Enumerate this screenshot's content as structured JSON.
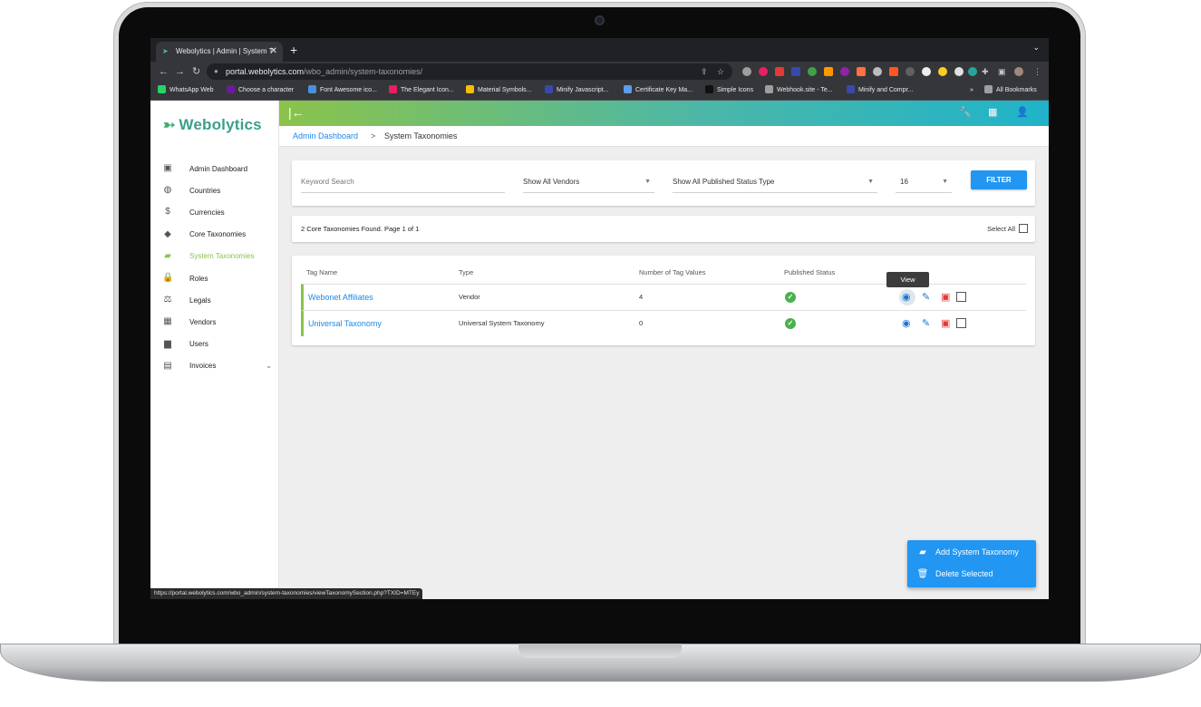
{
  "browser": {
    "tab_title": "Webolytics | Admin | System T",
    "tab_close": "✕",
    "new_tab": "+",
    "tab_menu": "⌄",
    "url_host": "portal.webolytics.com",
    "url_path": "/wbo_admin/system-taxonomies/",
    "bookmarks": [
      {
        "label": "WhatsApp Web",
        "color": "#25d366"
      },
      {
        "label": "Choose a character",
        "color": "#6a1b9a"
      },
      {
        "label": "Font Awesome ico...",
        "color": "#4a90d9"
      },
      {
        "label": "The Elegant Icon...",
        "color": "#e91e63"
      },
      {
        "label": "Material Symbols...",
        "color": "#fbbc04"
      },
      {
        "label": "Minify Javascript...",
        "color": "#3949ab"
      },
      {
        "label": "Certificate Key Ma...",
        "color": "#5c9ded"
      },
      {
        "label": "Simple Icons",
        "color": "#111111"
      },
      {
        "label": "Webhook.site - Te...",
        "color": "#9e9e9e"
      },
      {
        "label": "Minify and Compr...",
        "color": "#3949ab"
      }
    ],
    "bookmarks_overflow": "»",
    "all_bookmarks": "All Bookmarks",
    "status_url": "https://portal.webolytics.com/wbo_admin/system-taxonomies/viewTaxonomySection.php?TXID=MTEy"
  },
  "app": {
    "brand": "Webolytics",
    "sidebar": [
      {
        "label": "Admin Dashboard",
        "icon": "dashboard-icon",
        "glyph": "▣",
        "active": false
      },
      {
        "label": "Countries",
        "icon": "globe-icon",
        "glyph": "◍",
        "active": false
      },
      {
        "label": "Currencies",
        "icon": "dollar-icon",
        "glyph": "$",
        "active": false
      },
      {
        "label": "Core Taxonomies",
        "icon": "tags-icon",
        "glyph": "◆",
        "active": false
      },
      {
        "label": "System Taxonomies",
        "icon": "label-icon",
        "glyph": "▰",
        "active": true
      },
      {
        "label": "Roles",
        "icon": "lock-icon",
        "glyph": "🔒",
        "active": false
      },
      {
        "label": "Legals",
        "icon": "gavel-icon",
        "glyph": "⚖",
        "active": false
      },
      {
        "label": "Vendors",
        "icon": "building-icon",
        "glyph": "▦",
        "active": false
      },
      {
        "label": "Users",
        "icon": "folder-user-icon",
        "glyph": "▆",
        "active": false
      },
      {
        "label": "Invoices",
        "icon": "wallet-icon",
        "glyph": "▤",
        "active": false
      }
    ],
    "breadcrumb": {
      "home": "Admin Dashboard",
      "separator": ">",
      "current": "System Taxonomies"
    },
    "filters": {
      "keyword_placeholder": "Keyword Search",
      "vendor": "Show All Vendors",
      "status": "Show All Published Status Type",
      "per_page": "16",
      "button": "FILTER"
    },
    "results": {
      "summary": "2 Core Taxonomies Found. Page 1 of 1",
      "select_all": "Select All"
    },
    "table": {
      "headers": [
        "Tag Name",
        "Type",
        "Number of Tag Values",
        "Published Status"
      ],
      "rows": [
        {
          "name": "Webonet Affiliates",
          "type": "Vendor",
          "count": "4",
          "published": true
        },
        {
          "name": "Universal Taxonomy",
          "type": "Universal System Taxonomy",
          "count": "0",
          "published": true
        }
      ]
    },
    "tooltip": "View",
    "fab": {
      "add": "Add System Taxonomy",
      "delete": "Delete Selected"
    },
    "colors": {
      "accent": "#2196f3",
      "active": "#8bc34a",
      "link": "#1e88e5",
      "delete": "#e53935"
    }
  }
}
